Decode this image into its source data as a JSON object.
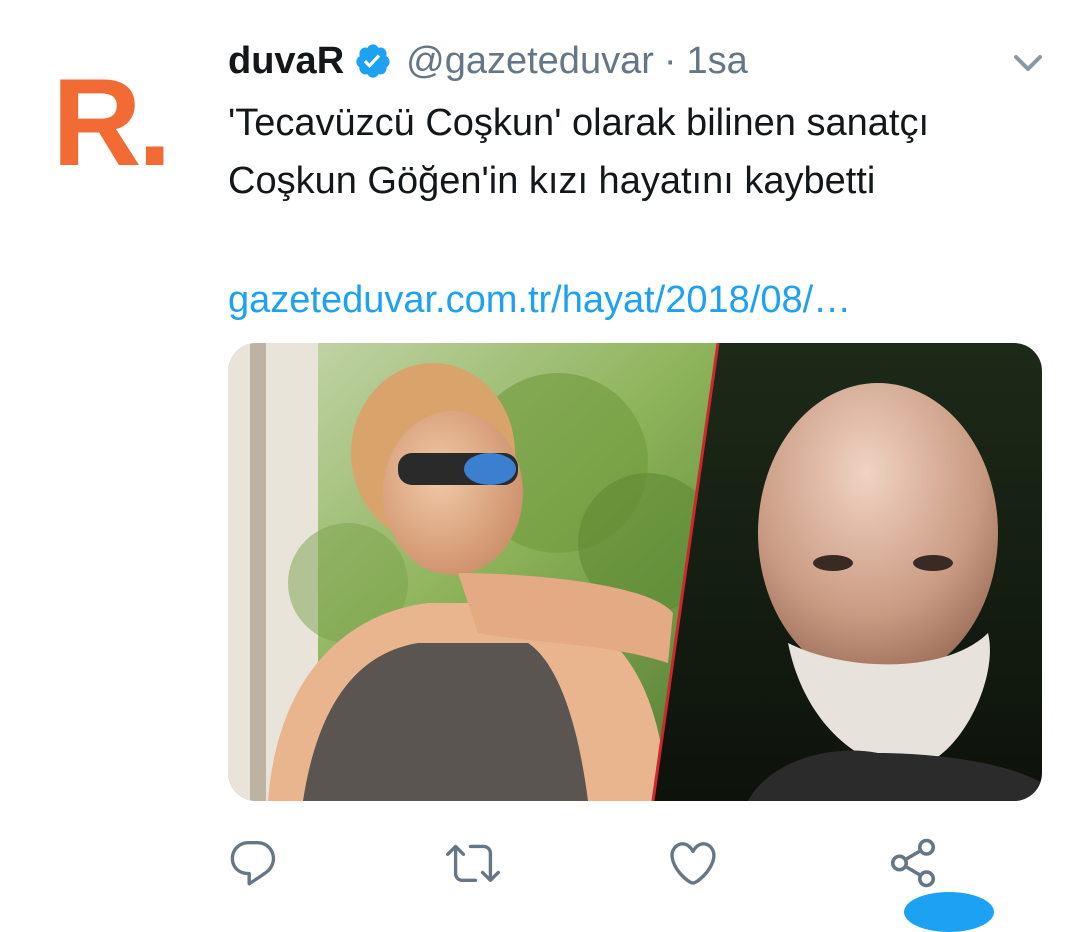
{
  "tweet": {
    "author_name": "duvaR",
    "handle": "@gazeteduvar",
    "separator": "·",
    "time": "1sa",
    "avatar_logo": "R.",
    "text": "'Tecavüzcü Coşkun' olarak bilinen sanatçı Coşkun Göğen'in kızı hayatını kaybetti",
    "link": "gazeteduvar.com.tr/hayat/2018/08/…"
  },
  "colors": {
    "link": "#1da1f2",
    "verified": "#1da1f2",
    "logo": "#f26a34",
    "secondary_text": "#657786"
  },
  "icons": {
    "reply": "reply-icon",
    "retweet": "retweet-icon",
    "like": "heart-icon",
    "share": "share-icon",
    "more": "chevron-down-icon",
    "verified": "verified-badge-icon"
  }
}
